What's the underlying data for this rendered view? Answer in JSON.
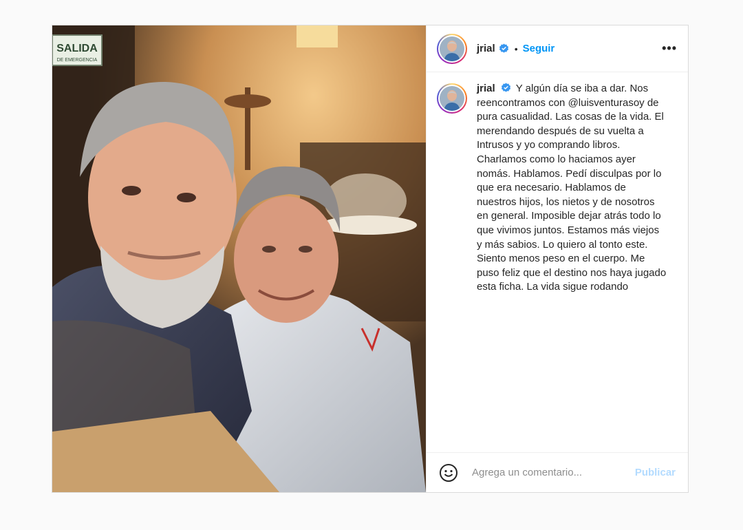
{
  "post": {
    "username": "jrial",
    "verified": true,
    "follow_label": "Seguir",
    "separator": "•",
    "more_label": "•••",
    "caption": "Y algún día se iba a dar. Nos reencontramos con @luisventurasoy de pura casualidad. Las cosas de la vida. El merendando después de su vuelta a Intrusos y yo comprando libros. Charlamos como lo haciamos ayer nomás. Hablamos. Pedí disculpas por lo que era necesario. Hablamos de nuestros hijos, los nietos y de nosotros en general. Imposible dejar atrás todo lo que vivimos juntos. Estamos más viejos y más sabios. Lo quiero al tonto este. Siento menos peso en el cuerpo. Me puso feliz que el destino nos haya jugado esta ficha. La vida sigue rodando",
    "photo_sign_text": "SALIDA",
    "photo_sign_subtext": "DE EMERGENCIA"
  },
  "comment": {
    "placeholder": "Agrega un comentario...",
    "publish_label": "Publicar"
  },
  "colors": {
    "link_blue": "#0095f6",
    "publish_disabled": "#b3dbff",
    "verified_blue": "#3897f0"
  },
  "icons": {
    "verified": "verified-badge-icon",
    "more": "more-options-icon",
    "emoji": "emoji-smile-icon"
  }
}
